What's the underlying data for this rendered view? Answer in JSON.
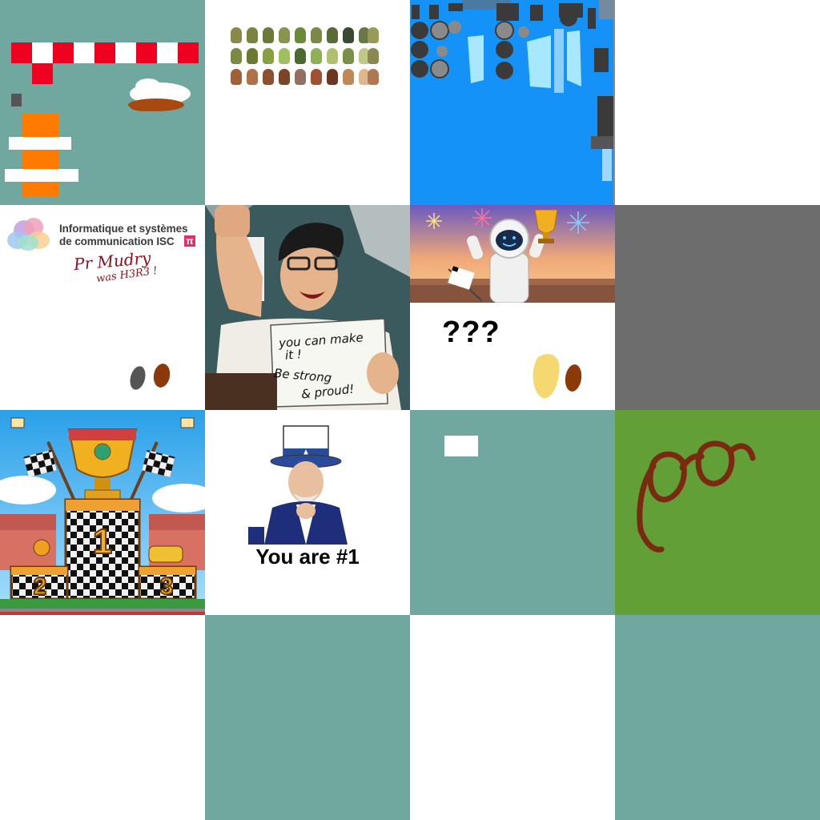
{
  "atlas": {
    "logo_tile": {
      "org_line1": "Informatique et systèmes",
      "org_line2": "de communication ISC",
      "pi_symbol": "π",
      "handwritten_line1": "Pr Mudry",
      "handwritten_line2": "was H3R3 !"
    },
    "coach_tile": {
      "sign_line1": "you can make",
      "sign_line2": "it !",
      "sign_line3": "Be strong",
      "sign_line4": "& proud!"
    },
    "astronaut_tile": {
      "mystery_text": "???"
    },
    "poster_tile": {
      "caption": "You are #1"
    },
    "podium_tile": {
      "first_place": "1",
      "second_place": "2",
      "third_place": "3"
    }
  },
  "colors": {
    "background_teal": "#70a8a0",
    "sky_blue": "#1492f8",
    "grass_green": "#5f9a35",
    "flag_red": "#f00020",
    "cone_orange": "#ff7a00",
    "glasses_brown": "#7a2a10"
  }
}
